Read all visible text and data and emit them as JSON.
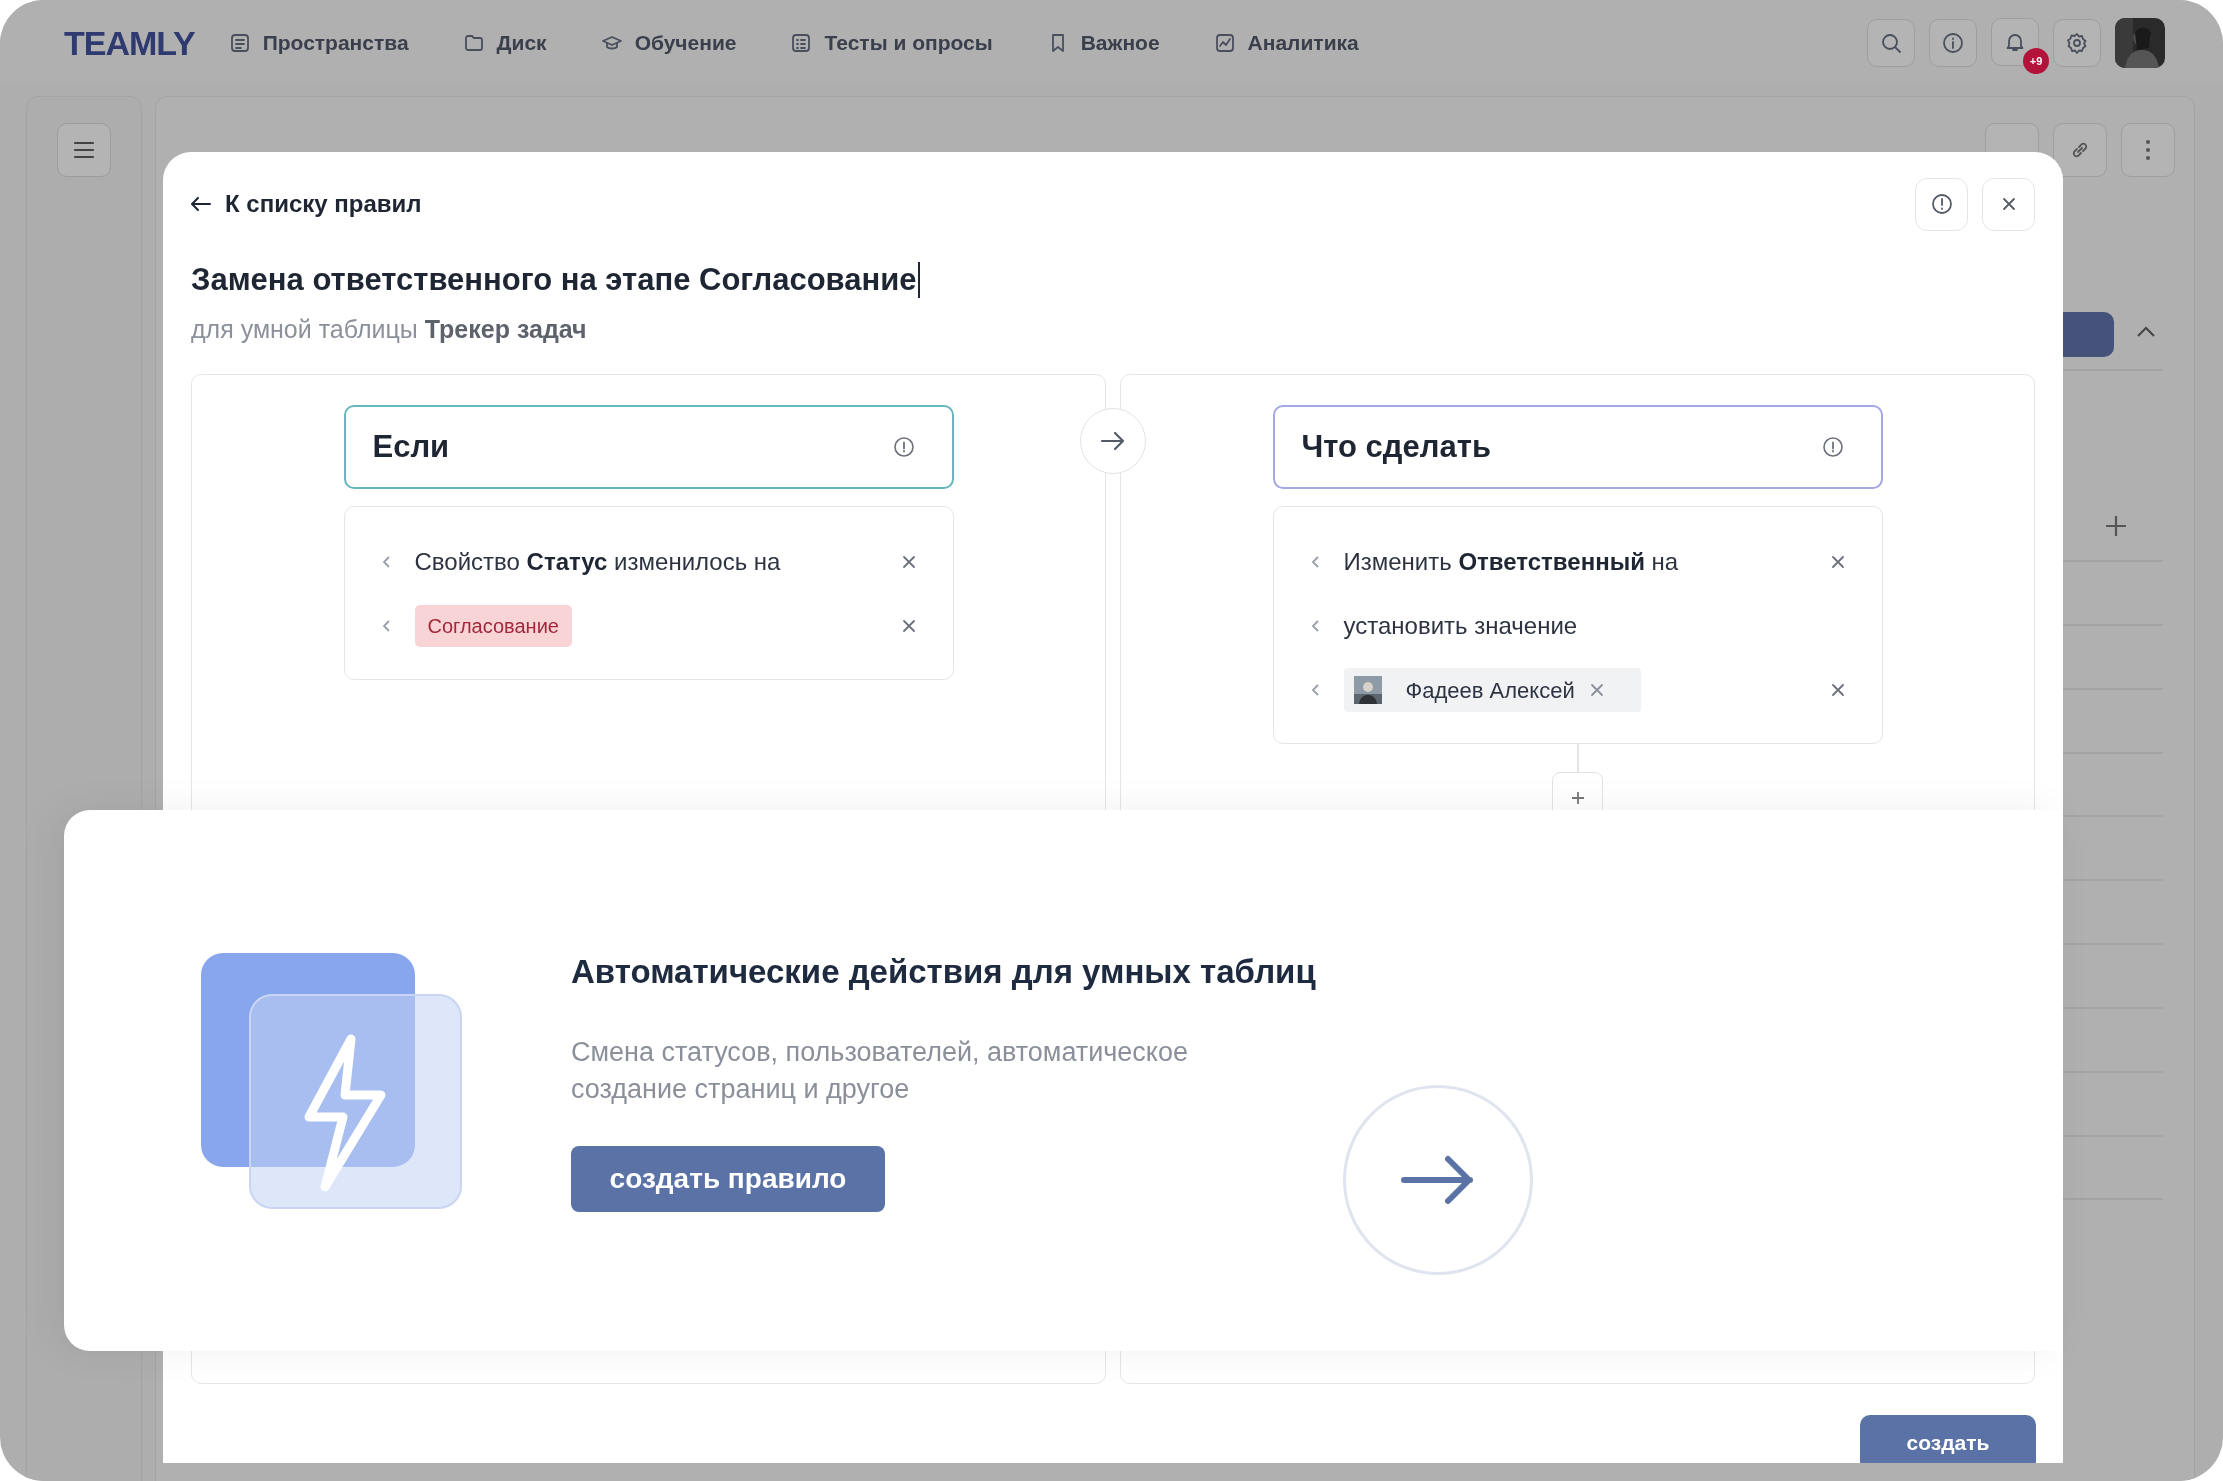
{
  "nav": {
    "logo": "TEAMLY",
    "items": [
      {
        "label": "Пространства"
      },
      {
        "label": "Диск"
      },
      {
        "label": "Обучение"
      },
      {
        "label": "Тесты и опросы"
      },
      {
        "label": "Важное"
      },
      {
        "label": "Аналитика"
      }
    ],
    "notifications_badge": "+9"
  },
  "dialog": {
    "back_link": "К списку правил",
    "title": "Замена ответственного на этапе Согласование",
    "subtitle": "для умной таблицы **Трекер задач**",
    "trigger": {
      "heading": "Если",
      "rows": [
        {
          "kind": "text",
          "text": "Свойство **Статус** изменилось на",
          "removable": true
        },
        {
          "kind": "tag",
          "text": "Согласование",
          "removable": true
        }
      ]
    },
    "action": {
      "heading": "Что сделать",
      "rows": [
        {
          "kind": "text",
          "text": "Изменить **Ответственный** на",
          "removable": true
        },
        {
          "kind": "text",
          "text": "установить значение",
          "removable": false
        },
        {
          "kind": "person",
          "text": "Фадеев Алексей",
          "removable": true
        }
      ]
    },
    "create_button": "создать"
  },
  "promo": {
    "title": "Автоматические действия для умных таблиц",
    "description": "Смена статусов, пользователей, автоматическое создание страниц и другое",
    "button": "создать правило"
  }
}
